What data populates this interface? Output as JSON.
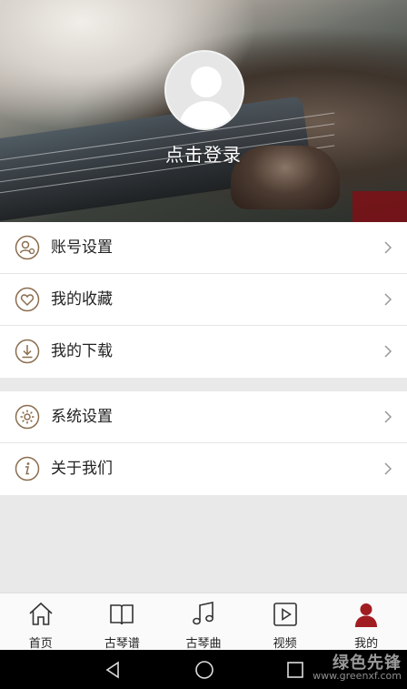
{
  "header": {
    "login_text": "点击登录"
  },
  "menu_group_1": [
    {
      "label": "账号设置",
      "icon": "account-settings-icon"
    },
    {
      "label": "我的收藏",
      "icon": "heart-icon"
    },
    {
      "label": "我的下载",
      "icon": "download-icon"
    }
  ],
  "menu_group_2": [
    {
      "label": "系统设置",
      "icon": "gear-icon"
    },
    {
      "label": "关于我们",
      "icon": "info-icon"
    }
  ],
  "tabbar": {
    "items": [
      {
        "label": "首页",
        "icon": "home-icon"
      },
      {
        "label": "古琴谱",
        "icon": "book-icon"
      },
      {
        "label": "古琴曲",
        "icon": "music-note-icon"
      },
      {
        "label": "视频",
        "icon": "video-play-icon"
      },
      {
        "label": "我的",
        "icon": "user-icon"
      }
    ],
    "active_index": 4,
    "accent_color": "#a01d22"
  },
  "watermark": {
    "title": "绿色先锋",
    "url": "www.greenxf.com"
  }
}
